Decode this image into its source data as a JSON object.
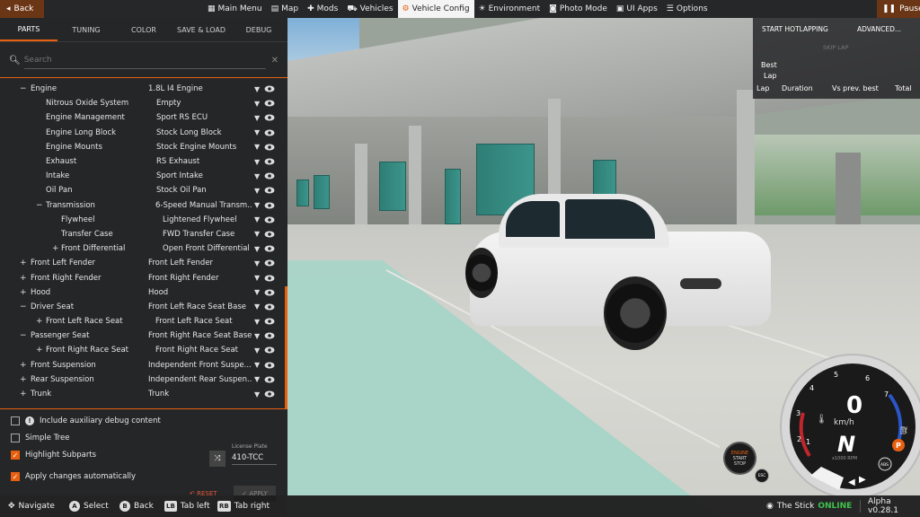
{
  "topbar": {
    "back_label": "Back",
    "pause_label": "Pause",
    "nav": [
      {
        "label": "Main Menu",
        "icon": "grid-icon"
      },
      {
        "label": "Map",
        "icon": "map-icon"
      },
      {
        "label": "Mods",
        "icon": "puzzle-icon"
      },
      {
        "label": "Vehicles",
        "icon": "car-icon"
      },
      {
        "label": "Vehicle Config",
        "icon": "engine-icon"
      },
      {
        "label": "Environment",
        "icon": "weather-icon"
      },
      {
        "label": "Photo Mode",
        "icon": "camera-icon"
      },
      {
        "label": "UI Apps",
        "icon": "apps-icon"
      },
      {
        "label": "Options",
        "icon": "sliders-icon"
      }
    ]
  },
  "panel": {
    "tabs": [
      "PARTS",
      "TUNING",
      "COLOR",
      "SAVE & LOAD",
      "DEBUG"
    ],
    "search_placeholder": "Search",
    "rows": [
      {
        "name": "Engine",
        "value": "1.8L I4 Engine",
        "toggle": "−",
        "level": 0
      },
      {
        "name": "Nitrous Oxide System",
        "value": "Empty",
        "toggle": "",
        "level": 1
      },
      {
        "name": "Engine Management",
        "value": "Sport RS ECU",
        "toggle": "",
        "level": 1
      },
      {
        "name": "Engine Long Block",
        "value": "Stock Long Block",
        "toggle": "",
        "level": 1
      },
      {
        "name": "Engine Mounts",
        "value": "Stock Engine Mounts",
        "toggle": "",
        "level": 1
      },
      {
        "name": "Exhaust",
        "value": "RS Exhaust",
        "toggle": "",
        "level": 1
      },
      {
        "name": "Intake",
        "value": "Sport Intake",
        "toggle": "",
        "level": 1
      },
      {
        "name": "Oil Pan",
        "value": "Stock Oil Pan",
        "toggle": "",
        "level": 1
      },
      {
        "name": "Transmission",
        "value": "6-Speed Manual Transm...",
        "toggle": "−",
        "level": 1
      },
      {
        "name": "Flywheel",
        "value": "Lightened Flywheel",
        "toggle": "",
        "level": 2
      },
      {
        "name": "Transfer Case",
        "value": "FWD Transfer Case",
        "toggle": "",
        "level": 2
      },
      {
        "name": "Front Differential",
        "value": "Open Front Differential",
        "toggle": "+",
        "level": 2
      },
      {
        "name": "Front Left Fender",
        "value": "Front Left Fender",
        "toggle": "+",
        "level": 0
      },
      {
        "name": "Front Right Fender",
        "value": "Front Right Fender",
        "toggle": "+",
        "level": 0
      },
      {
        "name": "Hood",
        "value": "Hood",
        "toggle": "+",
        "level": 0
      },
      {
        "name": "Driver Seat",
        "value": "Front Left Race Seat Base",
        "toggle": "−",
        "level": 0
      },
      {
        "name": "Front Left Race Seat",
        "value": "Front Left Race Seat",
        "toggle": "+",
        "level": 1
      },
      {
        "name": "Passenger Seat",
        "value": "Front Right Race Seat Base",
        "toggle": "−",
        "level": 0
      },
      {
        "name": "Front Right Race Seat",
        "value": "Front Right Race Seat",
        "toggle": "+",
        "level": 1
      },
      {
        "name": "Front Suspension",
        "value": "Independent Front Suspe...",
        "toggle": "+",
        "level": 0
      },
      {
        "name": "Rear Suspension",
        "value": "Independent Rear Suspen...",
        "toggle": "+",
        "level": 0
      },
      {
        "name": "Trunk",
        "value": "Trunk",
        "toggle": "+",
        "level": 0
      }
    ],
    "options": {
      "aux_debug": "Include auxiliary debug content",
      "simple_tree": "Simple Tree",
      "highlight_subparts": "Highlight Subparts",
      "apply_auto": "Apply changes automatically"
    },
    "license_plate_label": "License Plate",
    "license_plate_value": "410-TCC",
    "reset_label": "RESET",
    "apply_label": "APPLY"
  },
  "hotlap": {
    "start": "START HOTLAPPING",
    "advanced": "ADVANCED...",
    "skip": "SKIP LAP",
    "best": "Best",
    "lap": "Lap",
    "cols": [
      "Lap",
      "Duration",
      "Vs prev. best",
      "Total"
    ]
  },
  "gauge": {
    "speed": "0",
    "unit": "km/h",
    "gear": "N",
    "rpm_label": "x1000 RPM",
    "ticks": [
      "1",
      "2",
      "3",
      "4",
      "5",
      "6",
      "7"
    ],
    "engine_btn": [
      "ENGINE",
      "START",
      "STOP"
    ],
    "esc_label": "ESC",
    "abs_label": "ABS",
    "park_label": "P"
  },
  "bottombar": {
    "navigate": "Navigate",
    "select": "Select",
    "back": "Back",
    "tab_left": "Tab left",
    "tab_right": "Tab right",
    "select_key": "A",
    "back_key": "B",
    "tab_left_key": "LB",
    "tab_right_key": "RB",
    "user": "The Stick",
    "status": "ONLINE",
    "version": "Alpha v0.28.1"
  },
  "colors": {
    "accent": "#e8600f",
    "online": "#3fc24a",
    "back_button": "#6b3616"
  }
}
